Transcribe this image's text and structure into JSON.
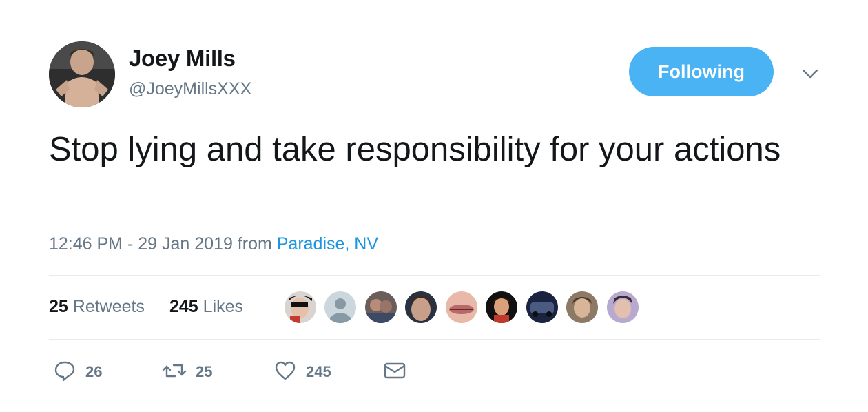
{
  "user": {
    "display_name": "Joey Mills",
    "handle": "@JoeyMillsXXX"
  },
  "follow_button": {
    "label": "Following",
    "color": "#4ab3f4"
  },
  "tweet": {
    "text": "Stop lying and take responsibility for your actions",
    "time": "12:46 PM - 29 Jan 2019 from ",
    "location": "Paradise, NV"
  },
  "stats": {
    "retweets_count": "25",
    "retweets_label": "Retweets",
    "likes_count": "245",
    "likes_label": "Likes"
  },
  "actions": {
    "reply_count": "26",
    "retweet_count": "25",
    "like_count": "245"
  },
  "colors": {
    "link": "#1b95e0",
    "secondary": "#657786",
    "divider": "#e6ecf0"
  },
  "icons": [
    "chevron-down-icon",
    "reply-icon",
    "retweet-icon",
    "heart-icon",
    "envelope-icon"
  ]
}
